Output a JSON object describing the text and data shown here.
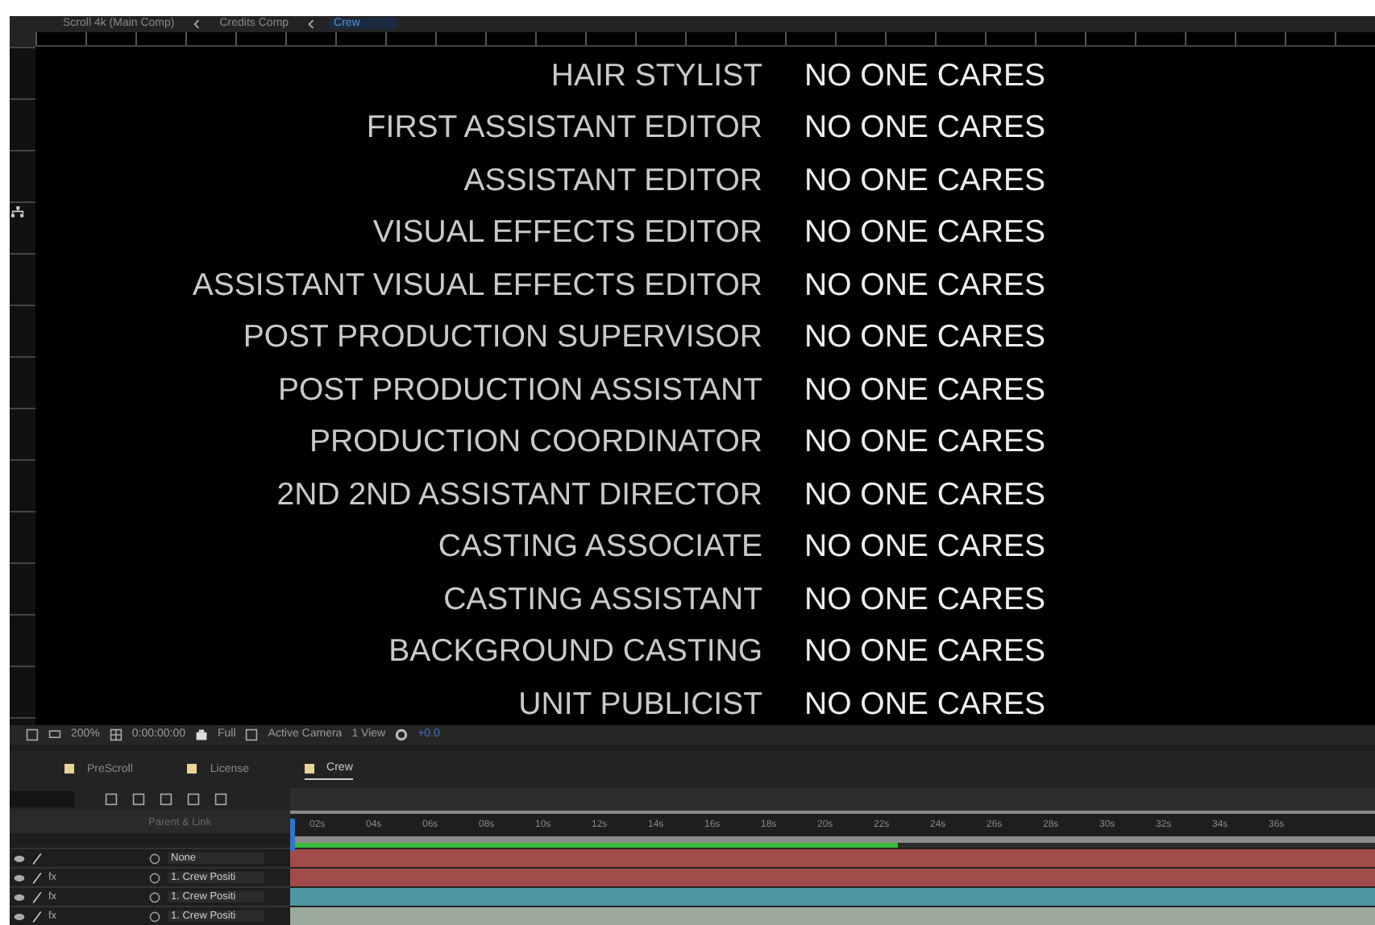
{
  "breadcrumbs": [
    {
      "label": "Scroll 4k (Main Comp)",
      "selected": false
    },
    {
      "label": "Credits Comp",
      "selected": false
    },
    {
      "label": "Crew",
      "selected": true
    }
  ],
  "credits": [
    {
      "role": "HAIR STYLIST",
      "name": "NO ONE CARES"
    },
    {
      "role": "FIRST ASSISTANT EDITOR",
      "name": "NO ONE CARES"
    },
    {
      "role": "ASSISTANT EDITOR",
      "name": "NO ONE CARES"
    },
    {
      "role": "VISUAL EFFECTS EDITOR",
      "name": "NO ONE CARES"
    },
    {
      "role": "ASSISTANT VISUAL EFFECTS EDITOR",
      "name": "NO ONE CARES"
    },
    {
      "role": "POST PRODUCTION SUPERVISOR",
      "name": "NO ONE CARES"
    },
    {
      "role": "POST PRODUCTION ASSISTANT",
      "name": "NO ONE CARES"
    },
    {
      "role": "PRODUCTION COORDINATOR",
      "name": "NO ONE CARES"
    },
    {
      "role": "2ND 2ND ASSISTANT DIRECTOR",
      "name": "NO ONE CARES"
    },
    {
      "role": "CASTING ASSOCIATE",
      "name": "NO ONE CARES"
    },
    {
      "role": "CASTING ASSISTANT",
      "name": "NO ONE CARES"
    },
    {
      "role": "BACKGROUND CASTING",
      "name": "NO ONE CARES"
    },
    {
      "role": "UNIT PUBLICIST",
      "name": "NO ONE CARES"
    }
  ],
  "viewer_toolbar": {
    "zoom": "200%",
    "timecode": "0:00:00:00",
    "resolution": "Full",
    "camera": "Active Camera",
    "views": "1 View",
    "exposure": "+0.0"
  },
  "comp_tabs": [
    {
      "label": "PreScroll",
      "selected": false
    },
    {
      "label": "License",
      "selected": false
    },
    {
      "label": "Crew",
      "selected": true
    }
  ],
  "timeline": {
    "column_header": "Parent & Link",
    "ticks": [
      "02s",
      "04s",
      "06s",
      "08s",
      "10s",
      "12s",
      "14s",
      "16s",
      "18s",
      "20s",
      "22s",
      "24s",
      "26s",
      "28s",
      "30s",
      "32s",
      "34s",
      "36s"
    ],
    "render_cache": {
      "level": 0.56
    },
    "layers": [
      {
        "parent": "None",
        "color": "#a24b4b"
      },
      {
        "parent": "1. Crew Positi",
        "color": "#a24b4b",
        "effects": "fx"
      },
      {
        "parent": "1. Crew Positi",
        "color": "#4d98a2",
        "effects": "fx"
      },
      {
        "parent": "1. Crew Positi",
        "color": "#9ba89c",
        "effects": "fx"
      }
    ]
  }
}
